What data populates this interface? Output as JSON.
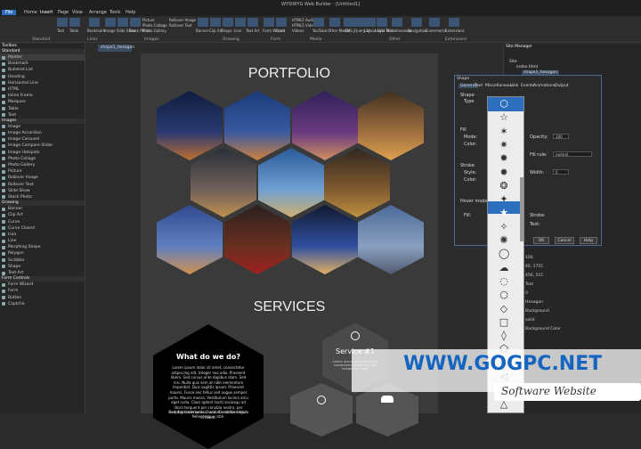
{
  "window": {
    "title": "WYSIWYG Web Builder - [Untitled1]"
  },
  "menu": [
    "File",
    "Home",
    "Insert",
    "Page",
    "View",
    "Arrange",
    "Tools",
    "Help"
  ],
  "ribbon": {
    "groups": [
      "Standard",
      "Links",
      "Images",
      "Drawing",
      "Form",
      "Media",
      "Other",
      "Extensions"
    ],
    "items": [
      "Text",
      "Table",
      "Bookmark",
      "Image",
      "Slide Show",
      "Stock Photo",
      "Picture",
      "Photo Collage",
      "Photo Gallery",
      "Rollover Image",
      "Rollover Text",
      "Banner",
      "Clip Art",
      "Shape",
      "Icon",
      "Text Art",
      "Form Wizard",
      "Form",
      "HTML5 Audio",
      "HTML5 Video",
      "YouTube",
      "Videos",
      "Other Media",
      "CMS",
      "jQuery UI",
      "Layout Grid",
      "Login Tools",
      "Miscellaneous",
      "Navigation",
      "Ecommerce",
      "Extensions"
    ]
  },
  "toolbox": {
    "title": "Toolbox",
    "sections": [
      {
        "name": "Standard",
        "items": [
          "Pointer",
          "Bookmark",
          "Bulleted List",
          "Heading",
          "Horizontal Line",
          "HTML",
          "Inline Frame",
          "Marquee",
          "Table",
          "Text"
        ]
      },
      {
        "name": "Images",
        "items": [
          "Image",
          "Image Accordion",
          "Image Carousel",
          "Image Compare Slider",
          "Image Hotspots",
          "Photo Collage",
          "Photo Gallery",
          "Picture",
          "Rollover Image",
          "Rollover Text",
          "Slide Show",
          "Stock Photo"
        ]
      },
      {
        "name": "Drawing",
        "items": [
          "Banner",
          "Clip Art",
          "Curve",
          "Curve Closed",
          "Icon",
          "Line",
          "Morphing Shape",
          "Polygon",
          "Scribble",
          "Shape",
          "Text Art"
        ]
      },
      {
        "name": "Form Controls",
        "items": [
          "Form Wizard",
          "Form",
          "Button",
          "Captcha"
        ]
      }
    ]
  },
  "doc_tab": "shape1_hexagon",
  "canvas": {
    "portfolio_title": "PORTFOLIO",
    "services_title": "SERVICES",
    "what_title": "What do we do?",
    "what_body": "Lorem ipsum dolor sit amet, consectetur adipiscing elit. Integer nec odio. Praesent libero. Sed cursus ante dapibus diam. Sed nisi. Nulla quis sem at nibh elementum imperdiet. Duis sagittis ipsum. Praesent mauris. Fusce nec tellus sed augue semper porta. Mauris massa. Vestibulum lacinia arcu eget nulla. Class aptent taciti sociosqu ad litora torquent per conubia nostra, per inceptos himenaeos. Curabitur sodales ligula in libero.",
    "what_body2": "Sed dignissim lacinia nunc. Curabitur tortor. Pellentesque nibh.",
    "service_title": "Service #1",
    "service_body": "Lorem ipsum dolor sit amet, consectetur adipiscing elit. Integer nec odio."
  },
  "site_manager": {
    "title": "Site Manager",
    "tree": [
      "Site",
      "index.html",
      "shape1_hexagon"
    ]
  },
  "shape_dialog": {
    "title": "Shape",
    "tabs": [
      "General",
      "Text",
      "Miscellaneous",
      "Link",
      "Events",
      "Animations",
      "Output"
    ],
    "labels": {
      "shape": "Shape",
      "type": "Type",
      "fill": "Fill",
      "mode": "Mode:",
      "color": "Color:",
      "opacity": "Opacity:",
      "fill_rule": "Fill rule:",
      "stroke": "Stroke",
      "style": "Style:",
      "width": "Width:",
      "hover": "Hover mode",
      "fill2": "Fill:",
      "stroke2": "Stroke:",
      "text": "Text:"
    },
    "values": {
      "opacity": "100",
      "fill_rule": "normal",
      "width": "0"
    },
    "buttons": [
      "OK",
      "Cancel",
      "Help"
    ]
  },
  "properties": {
    "values": [
      "100",
      "40, 1755",
      "456, 515",
      "0",
      "Hexagon",
      "solid"
    ],
    "labels": [
      "Text",
      "Background",
      "Background Color"
    ]
  },
  "watermark": {
    "url": "WWW.GOGPC.NET",
    "tagline": "Software Website"
  },
  "colors": {
    "accent": "#2e6fbd",
    "hex_fill": "#000000",
    "service_hex": "#4a4a4a",
    "watermark": "#1565c0"
  }
}
